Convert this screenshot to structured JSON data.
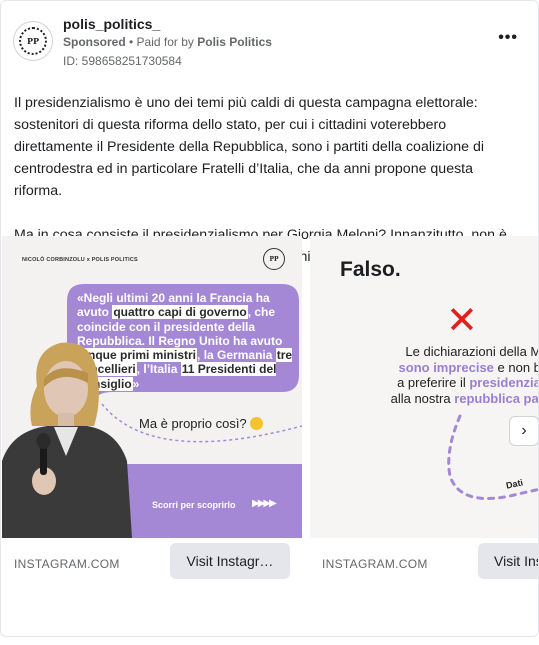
{
  "header": {
    "page_name": "polis_politics_",
    "avatar_text": "PP",
    "sponsored_label": "Sponsored",
    "separator": " • ",
    "paid_for_label": "Paid for by ",
    "payer": "Polis Politics",
    "ad_id": "ID: 598658251730584",
    "more_label": "•••"
  },
  "body": {
    "paragraph1": "Il presidenzialismo è uno dei temi più caldi di questa campagna elettorale: sostenitori di questa riforma dello stato, per cui i cittadini voterebbero direttamente il Presidente della Repubblica, sono i partiti della coalizione di centrodestra ed in particolare Fratelli d’Italia, che da anni propone questa riforma.",
    "paragraph2": "Ma in cosa consiste il presidenzialismo per Giorgia Meloni? Innanzitutto, non è un presidenzialismo, secondo il modello statunitense, ma un semipresidenzialismo…"
  },
  "carousel": {
    "slides": [
      {
        "credit": "NICOLÒ CORBINZOLU x POLIS POLITICS",
        "logo": "PP",
        "quote_parts": [
          {
            "t": "«Negli ultimi 20 anni la Francia ha avuto ",
            "hl": false
          },
          {
            "t": "quattro capi di governo",
            "hl": true
          },
          {
            "t": ", che coincide con il presidente della Repubblica. Il Regno Unito ha avuto ",
            "hl": false
          },
          {
            "t": "cinque primi ministri",
            "hl": true
          },
          {
            "t": ", la Germania ",
            "hl": false
          },
          {
            "t": "tre cancellieri",
            "hl": true
          },
          {
            "t": ", l’Italia ",
            "hl": false
          },
          {
            "t": "11 Presidenti del Consiglio",
            "hl": true
          },
          {
            "t": "»",
            "hl": false
          }
        ],
        "question": "Ma è proprio così?",
        "scroll_text": "Scorri per scoprirlo",
        "arrows": "▶▶▶▶",
        "domain": "INSTAGRAM.COM",
        "cta": "Visit Instagr…"
      },
      {
        "title": "Falso.",
        "x_mark": "✕",
        "line1_a": "Le dichiarazioni della Melo",
        "line2_a": "sono imprecise",
        "line2_b": " e non basta",
        "line3_a": "a preferire il ",
        "line3_b": "presidenzialism",
        "line4_a": "alla nostra ",
        "line4_b": "repubblica parlame",
        "dati": "Dati",
        "domain": "INSTAGRAM.COM",
        "cta": "Visit Ins"
      }
    ],
    "next_label": "›"
  },
  "colors": {
    "accent_purple": "#a488d6",
    "x_red": "#e0201a",
    "meta_grey": "#65676b",
    "button_bg": "#e4e6eb"
  }
}
